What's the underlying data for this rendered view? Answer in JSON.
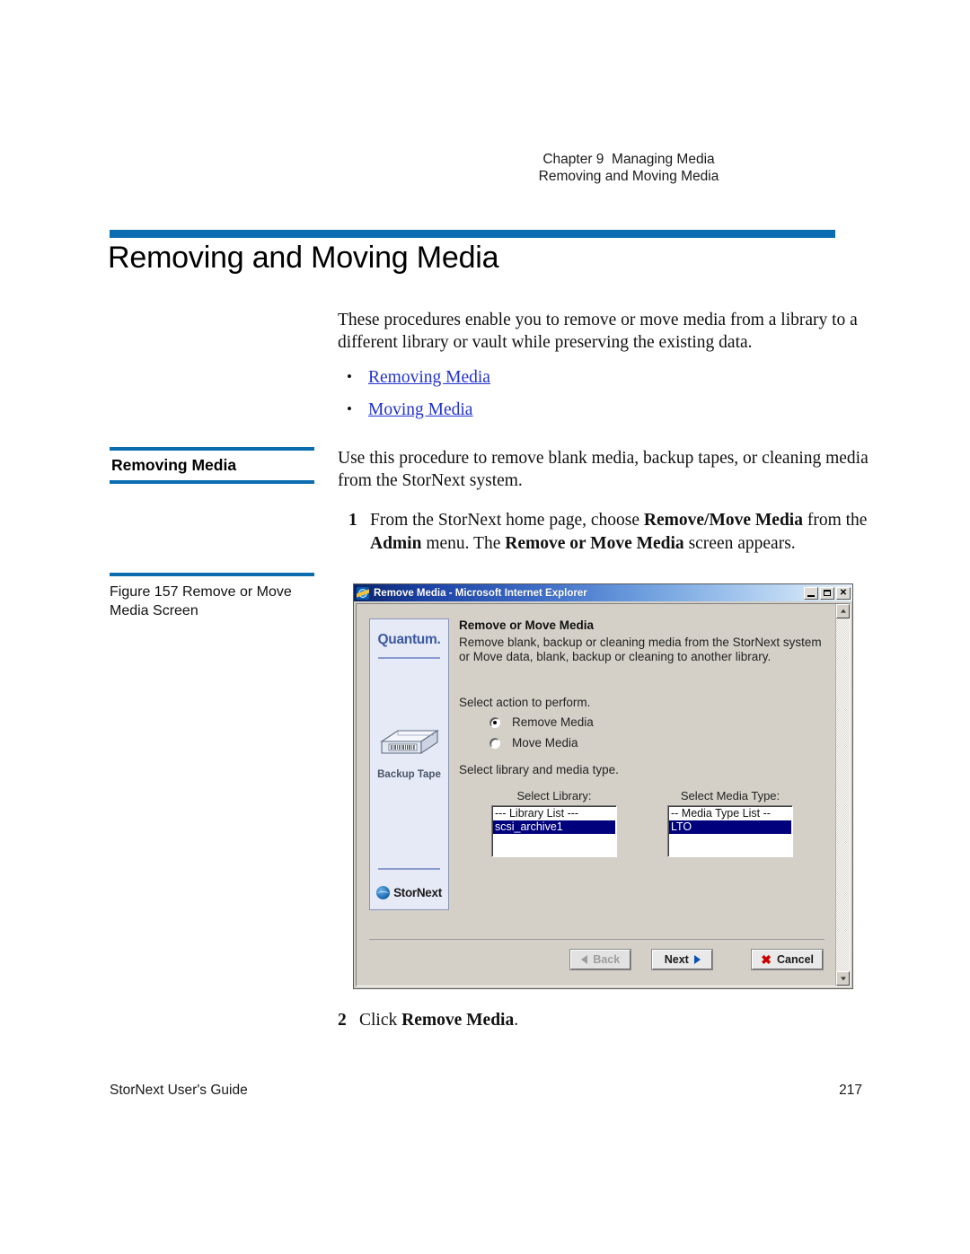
{
  "header": {
    "line1": "Chapter 9  Managing Media",
    "line2": "Removing and Moving Media"
  },
  "title": "Removing and Moving Media",
  "intro": {
    "paragraph": "These procedures enable you to remove or move media from a library to a different library or vault while preserving the existing data.",
    "links": [
      {
        "label": "Removing Media"
      },
      {
        "label": "Moving Media"
      }
    ]
  },
  "section": {
    "heading": "Removing Media",
    "intro": "Use this procedure to remove blank media, backup tapes, or cleaning media from the StorNext system.",
    "step1": {
      "number": "1",
      "part1": "From the StorNext home page, choose ",
      "bold1": "Remove/Move Media",
      "part2": " from the ",
      "bold2": "Admin",
      "part3": " menu. The ",
      "bold3": "Remove or Move Media",
      "part4": " screen appears."
    },
    "step2": {
      "number": "2",
      "part1": "Click ",
      "bold1": "Remove Media",
      "part2": "."
    }
  },
  "figure": {
    "caption": "Figure 157  Remove or Move Media Screen"
  },
  "screenshot": {
    "window_title": "Remove Media - Microsoft Internet Explorer",
    "window_buttons": {
      "minimize": "_",
      "maximize": "□",
      "close": "✕"
    },
    "brand_panel": {
      "company": "Quantum.",
      "graphic_caption": "Backup Tape",
      "product": "StorNext"
    },
    "dialog": {
      "heading": "Remove or Move Media",
      "description": "Remove blank, backup or cleaning media from the StorNext system or Move data, blank, backup or cleaning to another library.",
      "action_prompt": "Select action to perform.",
      "radios": [
        {
          "label": "Remove Media",
          "selected": true
        },
        {
          "label": "Move Media",
          "selected": false
        }
      ],
      "library_prompt": "Select library and media type.",
      "library_list": {
        "title": "Select Library:",
        "options": [
          {
            "label": "--- Library List ---",
            "selected": false
          },
          {
            "label": "scsi_archive1",
            "selected": true
          }
        ]
      },
      "media_type_list": {
        "title": "Select Media Type:",
        "options": [
          {
            "label": "-- Media Type List --",
            "selected": false
          },
          {
            "label": "LTO",
            "selected": true
          }
        ]
      },
      "buttons": {
        "back": "Back",
        "next": "Next",
        "cancel": "Cancel"
      }
    }
  },
  "footer": {
    "left": "StorNext User's Guide",
    "right": "217"
  },
  "colors": {
    "accent_blue": "#0b6cb0",
    "link_blue": "#2233cc",
    "selection_blue": "#00007c",
    "cancel_red": "#cc0000"
  }
}
